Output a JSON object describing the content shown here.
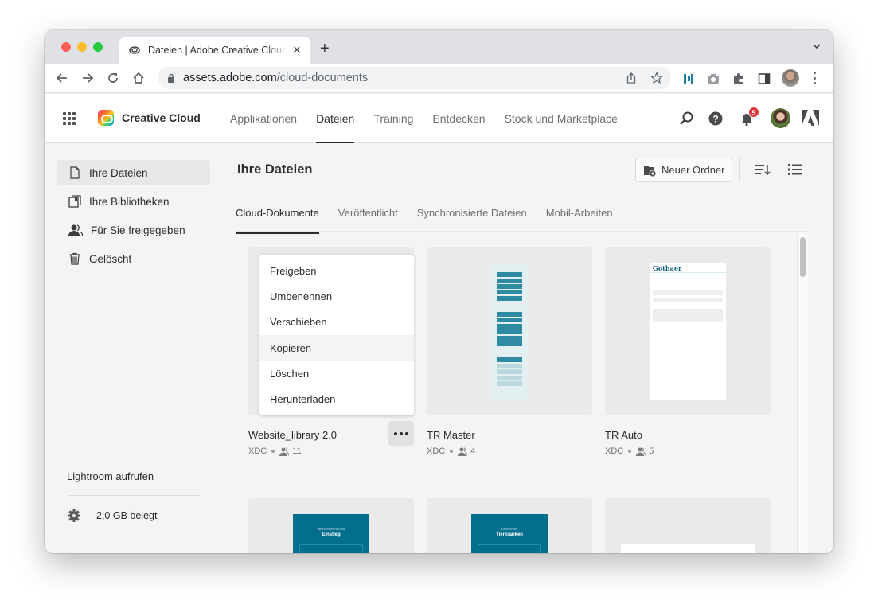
{
  "browser": {
    "tab_title": "Dateien | Adobe Creative Cloud",
    "url_host": "assets.adobe.com",
    "url_path": "/cloud-documents"
  },
  "header": {
    "brand": "Creative Cloud",
    "nav": [
      "Applikationen",
      "Dateien",
      "Training",
      "Entdecken",
      "Stock und Marketplace"
    ],
    "active_nav": "Dateien",
    "notification_count": "5"
  },
  "sidebar": {
    "items": [
      {
        "label": "Ihre Dateien",
        "icon": "file-icon",
        "active": true
      },
      {
        "label": "Ihre Bibliotheken",
        "icon": "library-icon",
        "active": false
      },
      {
        "label": "Für Sie freigegeben",
        "icon": "shared-people-icon",
        "active": false
      },
      {
        "label": "Gelöscht",
        "icon": "trash-icon",
        "active": false
      }
    ],
    "lightroom_link": "Lightroom aufrufen",
    "storage": "2,0 GB belegt"
  },
  "main": {
    "title": "Ihre Dateien",
    "new_folder_label": "Neuer Ordner",
    "tabs": [
      "Cloud-Dokumente",
      "Veröffentlicht",
      "Synchronisierte Dateien",
      "Mobil-Arbeiten"
    ],
    "active_tab": "Cloud-Dokumente",
    "files": [
      {
        "name": "Website_library 2.0",
        "type": "XDC",
        "collaborators": "11"
      },
      {
        "name": "TR Master",
        "type": "XDC",
        "collaborators": "4"
      },
      {
        "name": "TR Auto",
        "type": "XDC",
        "collaborators": "5"
      }
    ],
    "row2_thumbs": [
      {
        "small": "Tarifrechner Hausrat",
        "big": "Einstieg"
      },
      {
        "small": "Tarifrechner",
        "big": "Tierkranken"
      }
    ],
    "thumb_brand": "Gothaer"
  },
  "context_menu": {
    "items": [
      "Freigeben",
      "Umbenennen",
      "Verschieben",
      "Kopieren",
      "Löschen",
      "Herunterladen"
    ],
    "hovered": "Kopieren"
  }
}
